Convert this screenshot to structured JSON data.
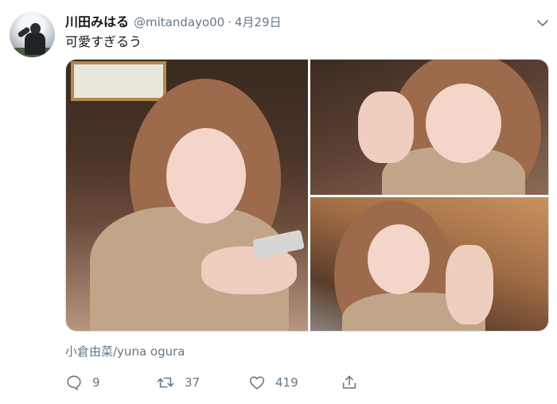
{
  "tweet": {
    "author_name": "川田みはる",
    "handle": "@mitandayo00",
    "separator": "·",
    "date": "4月29日",
    "text": "可愛すぎるう",
    "caption": "小倉由菜/yuna ogura"
  },
  "actions": {
    "reply_count": "9",
    "retweet_count": "37",
    "like_count": "419"
  },
  "icons": [
    "reply-icon",
    "retweet-icon",
    "like-icon",
    "share-icon",
    "chevron-down-icon"
  ],
  "colors": {
    "text": "#14171a",
    "muted": "#657786",
    "border": "#d8dee3"
  }
}
